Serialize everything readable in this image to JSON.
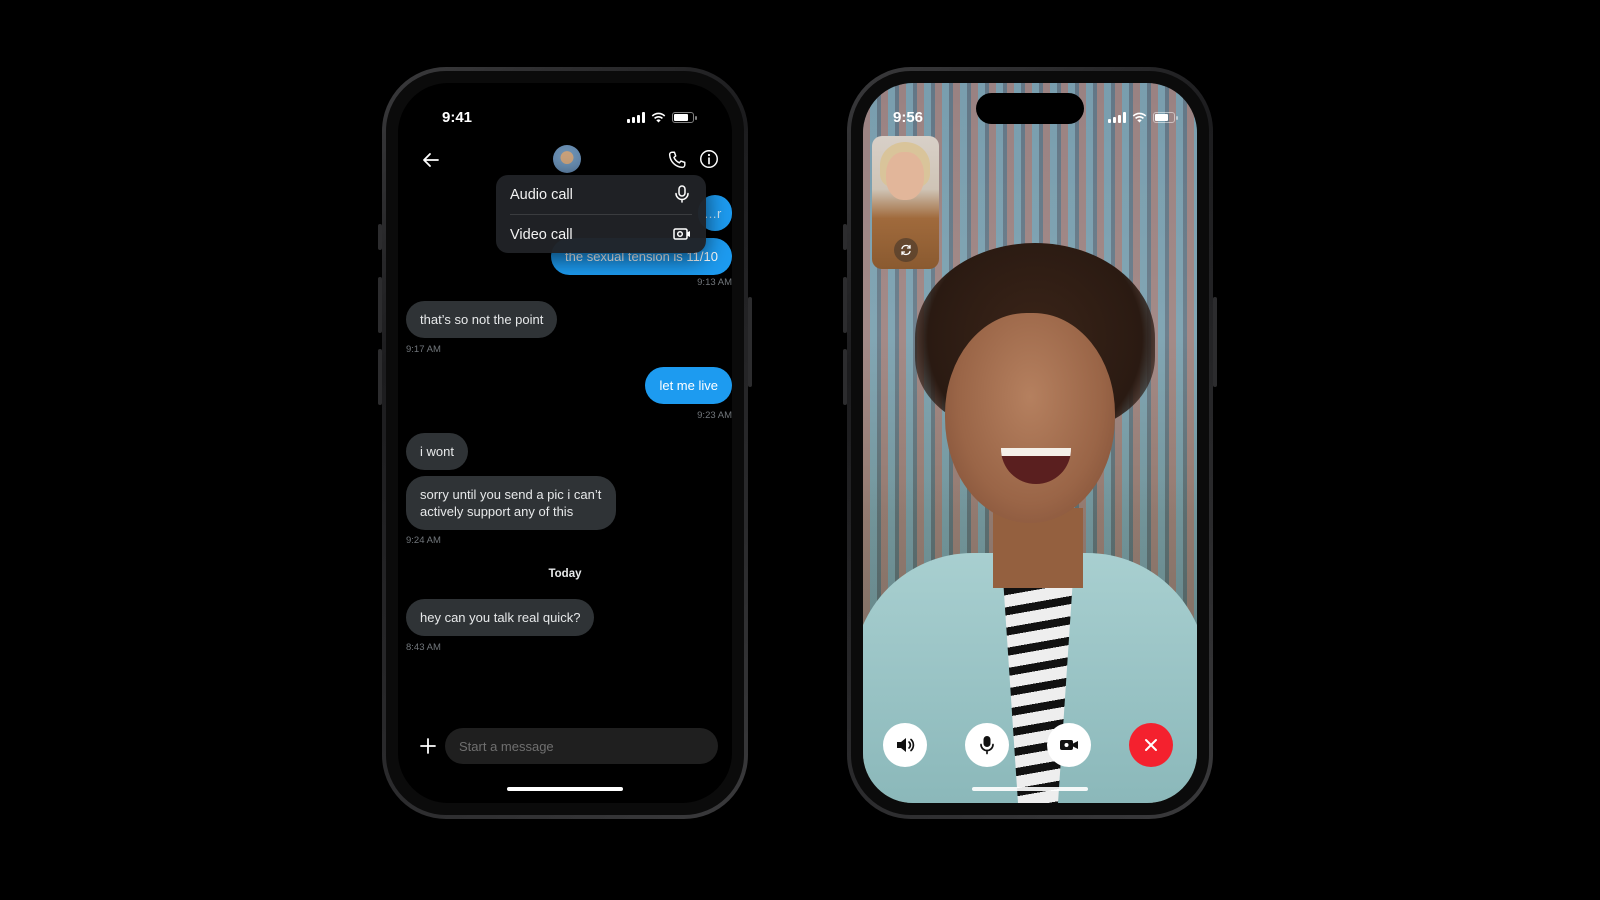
{
  "left_phone": {
    "status_bar": {
      "time": "9:41"
    },
    "header": {
      "back_icon": "arrow-left-icon",
      "avatar": "contact-avatar",
      "call_icon": "phone-icon",
      "info_icon": "info-icon"
    },
    "call_menu": {
      "items": [
        {
          "label": "Audio call",
          "icon": "microphone-icon"
        },
        {
          "label": "Video call",
          "icon": "video-camera-icon"
        }
      ]
    },
    "messages": [
      {
        "direction": "out",
        "text": "…r",
        "partial": true
      },
      {
        "direction": "out",
        "text": "the sexual tension is 11/10",
        "time": "9:13 AM"
      },
      {
        "direction": "in",
        "text": "that’s so not the point",
        "time": "9:17 AM"
      },
      {
        "direction": "out",
        "text": "let me live",
        "time": "9:23 AM"
      },
      {
        "direction": "in",
        "text": "i wont"
      },
      {
        "direction": "in",
        "text": "sorry until you send a pic i can’t actively support any of this",
        "time": "9:24 AM"
      },
      {
        "direction": "in",
        "text": "hey can you talk real quick?",
        "time": "8:43 AM"
      }
    ],
    "day_separator": "Today",
    "composer": {
      "add_icon": "plus-icon",
      "placeholder": "Start a message",
      "value": ""
    }
  },
  "right_phone": {
    "status_bar": {
      "time": "9:56"
    },
    "self_view": {
      "flip_icon": "camera-flip-icon"
    },
    "controls": [
      {
        "name": "speaker",
        "icon": "speaker-icon"
      },
      {
        "name": "mute",
        "icon": "microphone-icon"
      },
      {
        "name": "camera",
        "icon": "video-camera-icon"
      },
      {
        "name": "end-call",
        "icon": "close-icon"
      }
    ]
  },
  "colors": {
    "accent_blue": "#1d9bf0",
    "incoming_bubble": "#2f3336",
    "end_call_red": "#f4212e",
    "timestamp_gray": "#71767b"
  }
}
